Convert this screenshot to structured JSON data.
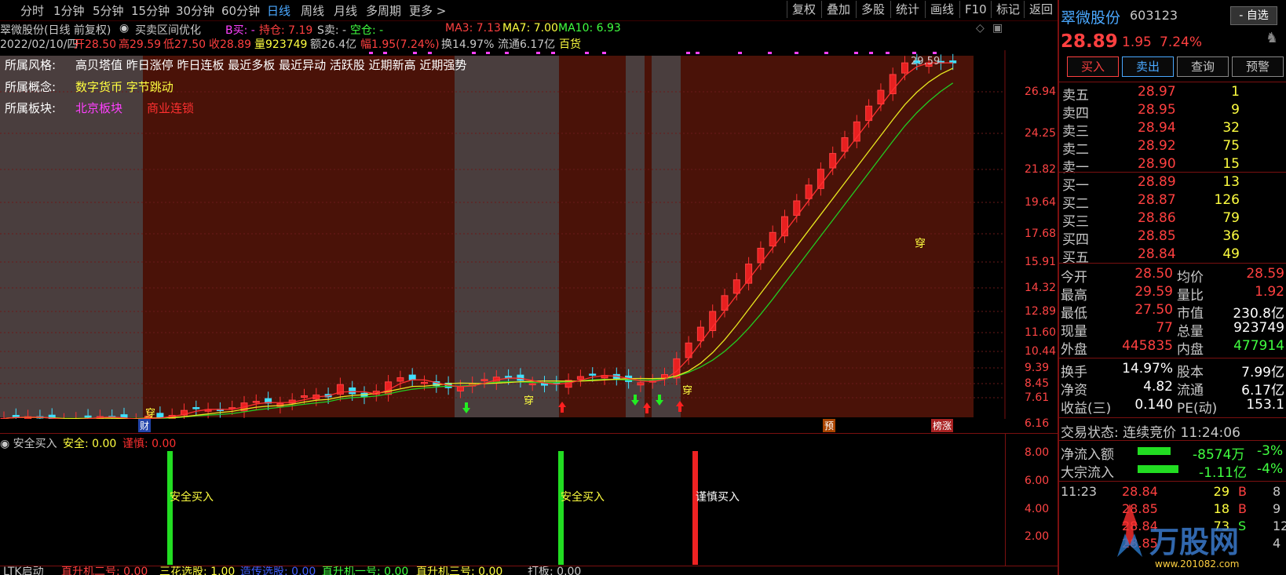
{
  "toolbar": {
    "timeframes": [
      "分时",
      "1分钟",
      "5分钟",
      "15分钟",
      "30分钟",
      "60分钟",
      "日线",
      "周线",
      "月线",
      "多周期",
      "更多 >"
    ],
    "active_timeframe": "日线",
    "right_tools": [
      "复权",
      "叠加",
      "多股",
      "统计",
      "画线",
      "F10",
      "标记",
      "返回"
    ]
  },
  "chart_title": {
    "name": "翠微股份(日线 前复权)",
    "indicator": "买卖区间优化",
    "b_sell": "B买: -",
    "hold": "持仓: 7.19",
    "s_sell": "S卖: -",
    "empty": "空仓: -",
    "ma3": "MA3: 7.13",
    "ma7": "MA7: 7.00",
    "ma10": "MA10: 6.93"
  },
  "ohlc_line": {
    "date": "2022/02/10/四",
    "open": "开28.50",
    "high": "高29.59",
    "low": "低27.50",
    "close": "收28.89",
    "volume": "量923749",
    "amount": "额26.4亿",
    "change": "幅1.95(7.24%)",
    "turnover": "换14.97%",
    "float": "流通6.17亿",
    "sector": "百货"
  },
  "overlay": {
    "style_label": "所属风格:",
    "style_value": "高贝塔值 昨日涨停 昨日连板 最近多板 最近异动 活跃股 近期新高 近期强势",
    "concept_label": "所属概念:",
    "concept_value": "数字货币 字节跳动",
    "block_label": "所属板块:",
    "block_a": "北京板块",
    "block_b": "商业连锁"
  },
  "price_axis": [
    "26.94",
    "24.25",
    "21.82",
    "19.64",
    "17.68",
    "15.91",
    "14.32",
    "12.89",
    "11.60",
    "10.44",
    "9.39",
    "8.45",
    "7.61",
    "6.16"
  ],
  "high_marker": "29.59",
  "chart_markers": {
    "chuan": "穿",
    "cai": "财",
    "yu": "预",
    "bang": "榜涨"
  },
  "lower_indicator": {
    "name": "安全买入",
    "safe_label": "安全: 0.00",
    "careful_label": "谨慎: 0.00",
    "axis": [
      "8.00",
      "6.00",
      "4.00",
      "2.00"
    ],
    "signals": [
      "安全买入",
      "安全买入",
      "谨慎买入"
    ]
  },
  "footer_indicator": {
    "name": "LTK启动",
    "items": [
      "直升机二号: 0.00",
      "三花选股: 1.00",
      "造传选股: 0.00",
      "直升机一号: 0.00",
      "直升机三号: 0.00",
      "打板: 0.00"
    ]
  },
  "panel": {
    "stock_name": "翠微股份",
    "stock_code": "603123",
    "watch_button": "- 自选",
    "price": "28.89",
    "change": "1.95",
    "pct": "7.24%",
    "buttons": [
      "买入",
      "卖出",
      "查询",
      "预警"
    ],
    "asks": [
      {
        "name": "卖五",
        "price": "28.97",
        "vol": "1"
      },
      {
        "name": "卖四",
        "price": "28.95",
        "vol": "9"
      },
      {
        "name": "卖三",
        "price": "28.94",
        "vol": "32"
      },
      {
        "name": "卖二",
        "price": "28.92",
        "vol": "75"
      },
      {
        "name": "卖一",
        "price": "28.90",
        "vol": "15"
      }
    ],
    "bids": [
      {
        "name": "买一",
        "price": "28.89",
        "vol": "13"
      },
      {
        "name": "买二",
        "price": "28.87",
        "vol": "126"
      },
      {
        "name": "买三",
        "price": "28.86",
        "vol": "79"
      },
      {
        "name": "买四",
        "price": "28.85",
        "vol": "36"
      },
      {
        "name": "买五",
        "price": "28.84",
        "vol": "49"
      }
    ],
    "stats": [
      [
        "今开",
        "28.50",
        "均价",
        "28.59"
      ],
      [
        "最高",
        "29.59",
        "量比",
        "1.92"
      ],
      [
        "最低",
        "27.50",
        "市值",
        "230.8亿"
      ],
      [
        "现量",
        "77",
        "总量",
        "923749"
      ],
      [
        "外盘",
        "445835",
        "内盘",
        "477914"
      ]
    ],
    "stats2": [
      [
        "换手",
        "14.97%",
        "股本",
        "7.99亿"
      ],
      [
        "净资",
        "4.82",
        "流通",
        "6.17亿"
      ],
      [
        "收益(三)",
        "0.140",
        "PE(动)",
        "153.1"
      ]
    ],
    "trade_state": "交易状态: 连续竞价 11:24:06",
    "net_inflow_label": "净流入额",
    "net_inflow_value": "-8574万",
    "net_inflow_pct": "-3%",
    "block_inflow_label": "大宗流入",
    "block_inflow_value": "-1.11亿",
    "block_inflow_pct": "-4%",
    "ticks": [
      {
        "time": "11:23",
        "price": "28.84",
        "vol": "29",
        "side": "B",
        "n": "8"
      },
      {
        "time": "",
        "price": "28.85",
        "vol": "18",
        "side": "B",
        "n": "9"
      },
      {
        "time": "",
        "price": "28.84",
        "vol": "73",
        "side": "S",
        "n": "12"
      },
      {
        "time": "",
        "price": "28.85",
        "vol": "",
        "side": "",
        "n": "4"
      }
    ],
    "watermark": "万股网",
    "watermark_url": "www.201082.com"
  },
  "chart_data": {
    "type": "candlestick",
    "ma_series": [
      "MA3",
      "MA7",
      "MA10"
    ],
    "price_ticks": [
      26.94,
      24.25,
      21.82,
      19.64,
      17.68,
      15.91,
      14.32,
      12.89,
      11.6,
      10.44,
      9.39,
      8.45,
      7.61,
      6.16
    ],
    "last_close": 28.89,
    "high": 29.59,
    "low": 27.5,
    "open": 28.5
  }
}
